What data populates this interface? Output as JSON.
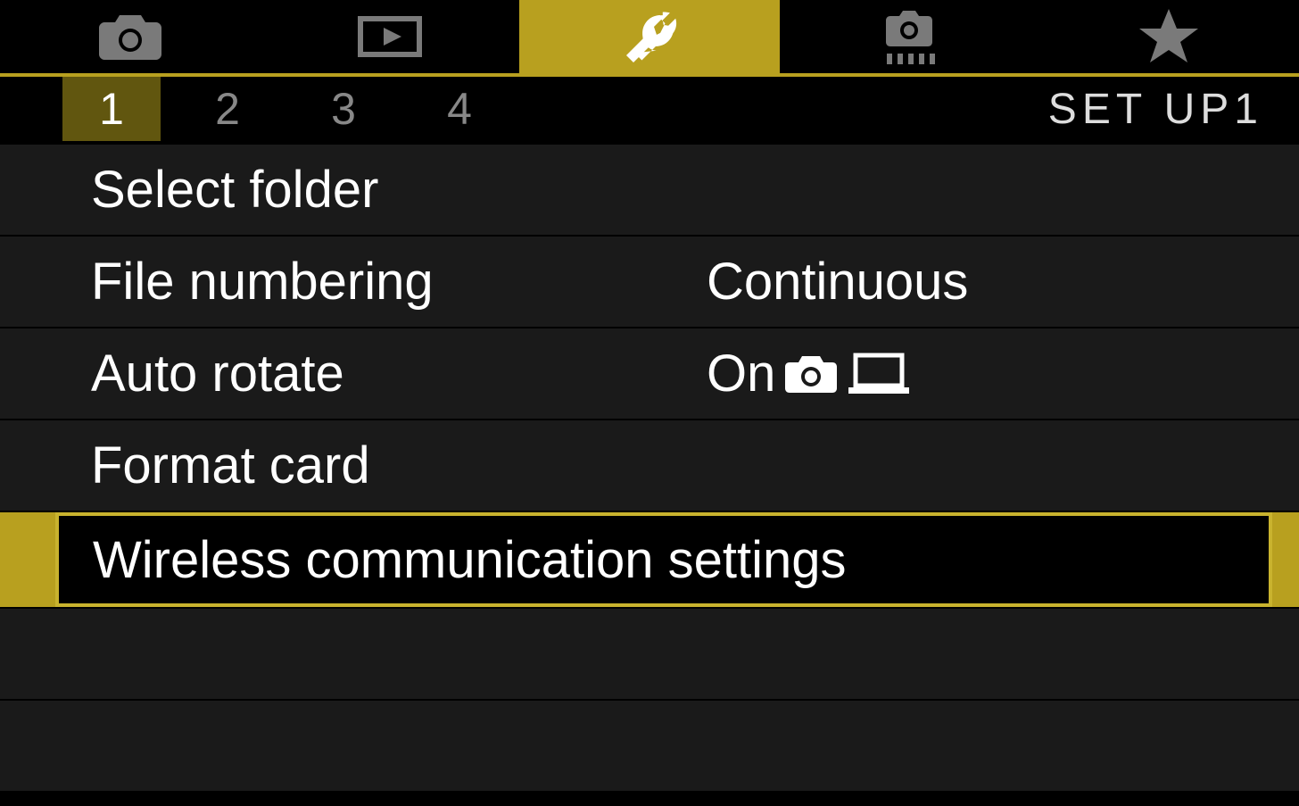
{
  "tabs": {
    "items": [
      {
        "icon": "camera-icon",
        "active": false
      },
      {
        "icon": "playback-icon",
        "active": false
      },
      {
        "icon": "wrench-icon",
        "active": true
      },
      {
        "icon": "custom-functions-icon",
        "active": false
      },
      {
        "icon": "star-icon",
        "active": false
      }
    ]
  },
  "subtabs": {
    "pages": [
      "1",
      "2",
      "3",
      "4"
    ],
    "active_index": 0,
    "section_label": "SET UP1"
  },
  "menu": {
    "items": [
      {
        "label": "Select folder",
        "value": "",
        "selected": false
      },
      {
        "label": "File numbering",
        "value": "Continuous",
        "selected": false
      },
      {
        "label": "Auto rotate",
        "value": "On",
        "value_icons": [
          "camera-small-icon",
          "laptop-icon"
        ],
        "selected": false
      },
      {
        "label": "Format card",
        "value": "",
        "selected": false
      },
      {
        "label": "Wireless communication settings",
        "value": "",
        "selected": true
      }
    ],
    "empty_rows": 2
  },
  "colors": {
    "accent": "#b8a01f",
    "row_bg": "#1a1a1a",
    "inactive_icon": "#7a7a7a"
  }
}
